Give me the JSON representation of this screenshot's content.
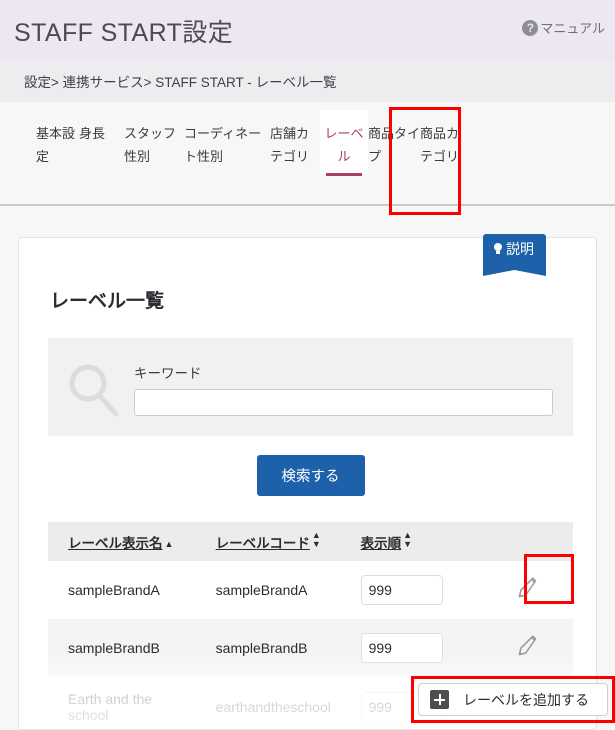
{
  "header": {
    "title": "STAFF START設定",
    "manual_label": "マニュアル",
    "help_icon": "question-circle-icon"
  },
  "breadcrumb": "設定> 連携サービス> STAFF START - レーベル一覧",
  "tabs": [
    {
      "label": "基本設定",
      "active": false
    },
    {
      "label": "身長",
      "active": false
    },
    {
      "label": "スタッフ性別",
      "active": false
    },
    {
      "label": "コーディネート性別",
      "active": false
    },
    {
      "label": "店舗カテゴリ",
      "active": false
    },
    {
      "label": "レーベル",
      "active": true
    },
    {
      "label": "商品タイプ",
      "active": false
    },
    {
      "label": "商品カテゴリ",
      "active": false
    }
  ],
  "ribbon": {
    "label": "説明",
    "icon": "lightbulb-icon"
  },
  "card": {
    "title": "レーベル一覧",
    "search": {
      "icon": "search-icon",
      "keyword_label": "キーワード",
      "keyword_value": "",
      "keyword_placeholder": "",
      "submit_label": "検索する"
    },
    "table": {
      "columns": [
        {
          "label": "レーベル表示名",
          "sort": "asc"
        },
        {
          "label": "レーベルコード",
          "sort": "none"
        },
        {
          "label": "表示順",
          "sort": "none"
        },
        {
          "label": "",
          "sort": null
        }
      ],
      "rows": [
        {
          "name": "sampleBrandA",
          "code": "sampleBrandA",
          "order": "999",
          "edit_icon": "pencil-icon"
        },
        {
          "name": "sampleBrandB",
          "code": "sampleBrandB",
          "order": "999",
          "edit_icon": "pencil-icon"
        },
        {
          "name": "Earth and the school",
          "code": "earthandtheschool",
          "order": "999",
          "edit_icon": "pencil-icon"
        }
      ]
    }
  },
  "add_button": {
    "label": "レーベルを追加する",
    "icon": "plus-square-icon"
  },
  "colors": {
    "header_bg": "#ece7f0",
    "accent_blue": "#1e61ab",
    "active_tab": "#a8415e",
    "annotation": "#ff0000"
  }
}
